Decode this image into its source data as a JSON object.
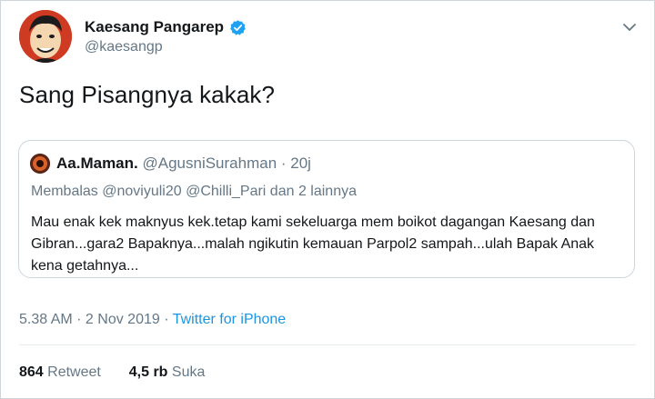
{
  "author": {
    "name": "Kaesang Pangarep",
    "handle": "@kaesangp",
    "verified": true,
    "avatar_icon": "caricature-avatar"
  },
  "tweet": {
    "text": "Sang Pisangnya kakak?",
    "time": "5.38 AM",
    "separator": " · ",
    "date": "2 Nov 2019",
    "source": "Twitter for iPhone"
  },
  "quoted": {
    "name": "Aa.Maman.",
    "handle": "@AgusniSurahman",
    "time": "· 20j",
    "reply_to": "Membalas @noviyuli20 @Chilli_Pari dan 2 lainnya",
    "text": "Mau enak kek maknyus kek.tetap kami sekeluarga mem boikot dagangan Kaesang dan Gibran...gara2 Bapaknya...malah ngikutin kemauan Parpol2 sampah...ulah Bapak Anak kena getahnya..."
  },
  "stats": {
    "retweets_count": "864",
    "retweets_label": "Retweet",
    "likes_count": "4,5 rb",
    "likes_label": "Suka"
  },
  "colors": {
    "text": "#14171a",
    "secondary": "#657786",
    "link": "#1b95e0",
    "verified": "#1da1f2",
    "border": "#ccd6dd"
  }
}
